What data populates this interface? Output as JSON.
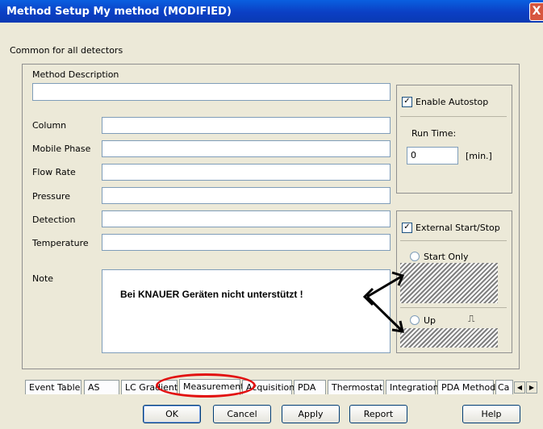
{
  "window": {
    "title": "Method Setup My method (MODIFIED)",
    "close_glyph": "X"
  },
  "common_label": "Common for all detectors",
  "form": {
    "method_description_label": "Method Description",
    "method_description_value": "",
    "fields": [
      {
        "label": "Column",
        "value": ""
      },
      {
        "label": "Mobile Phase",
        "value": ""
      },
      {
        "label": "Flow Rate",
        "value": ""
      },
      {
        "label": "Pressure",
        "value": ""
      },
      {
        "label": "Detection",
        "value": ""
      },
      {
        "label": "Temperature",
        "value": ""
      }
    ],
    "note_label": "Note"
  },
  "autostop": {
    "enable_label": "Enable Autostop",
    "enabled": true,
    "run_time_label": "Run Time:",
    "run_time_value": "0",
    "unit": "[min.]"
  },
  "external": {
    "label": "External Start/Stop",
    "checked": true,
    "start_only_label": "Start Only",
    "up_label": "Up",
    "edge_glyph": "⎍"
  },
  "annotation": {
    "text": "Bei KNAUER Geräten nicht unterstützt !"
  },
  "tabs": [
    {
      "label": "Event Table"
    },
    {
      "label": "AS"
    },
    {
      "label": "LC Gradient"
    },
    {
      "label": "Measurement",
      "active": true
    },
    {
      "label": "Acquisition"
    },
    {
      "label": "PDA"
    },
    {
      "label": "Thermostat"
    },
    {
      "label": "Integration"
    },
    {
      "label": "PDA Method"
    },
    {
      "label": "Ca"
    }
  ],
  "tab_scroll": {
    "left": "◀",
    "right": "▶"
  },
  "buttons": {
    "ok": "OK",
    "cancel": "Cancel",
    "apply": "Apply",
    "report": "Report",
    "help": "Help"
  }
}
